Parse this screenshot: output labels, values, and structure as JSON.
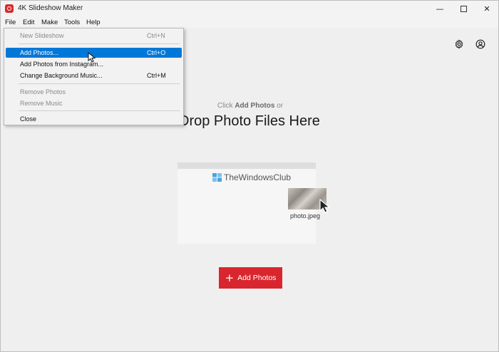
{
  "window": {
    "title": "4K Slideshow Maker",
    "controls": {
      "minimize": "—",
      "close": "✕"
    }
  },
  "menubar": {
    "items": [
      {
        "label": "File"
      },
      {
        "label": "Edit"
      },
      {
        "label": "Make"
      },
      {
        "label": "Tools"
      },
      {
        "label": "Help"
      }
    ]
  },
  "file_menu": {
    "items": [
      {
        "label": "New Slideshow",
        "shortcut": "Ctrl+N",
        "enabled": false
      },
      {
        "label": "Add Photos...",
        "shortcut": "Ctrl+O",
        "enabled": true,
        "highlighted": true
      },
      {
        "label": "Add Photos from Instagram...",
        "shortcut": "",
        "enabled": true
      },
      {
        "label": "Change Background Music...",
        "shortcut": "Ctrl+M",
        "enabled": true
      },
      {
        "label": "Remove Photos",
        "shortcut": "",
        "enabled": false
      },
      {
        "label": "Remove Music",
        "shortcut": "",
        "enabled": false
      },
      {
        "label": "Close",
        "shortcut": "",
        "enabled": true
      }
    ]
  },
  "toolbar": {
    "icons": [
      "gear-icon",
      "account-icon"
    ]
  },
  "dropzone": {
    "hint_prefix": "Click",
    "hint_bold": "Add Photos",
    "hint_suffix": "or",
    "title": "Drop Photo Files Here",
    "watermark": "TheWindowsClub",
    "file_name": "photo.jpeg"
  },
  "add_button": {
    "icon": "+",
    "label": "Add Photos",
    "color": "#d9262e"
  },
  "colors": {
    "highlight": "#0078d7",
    "background": "#efefef"
  }
}
